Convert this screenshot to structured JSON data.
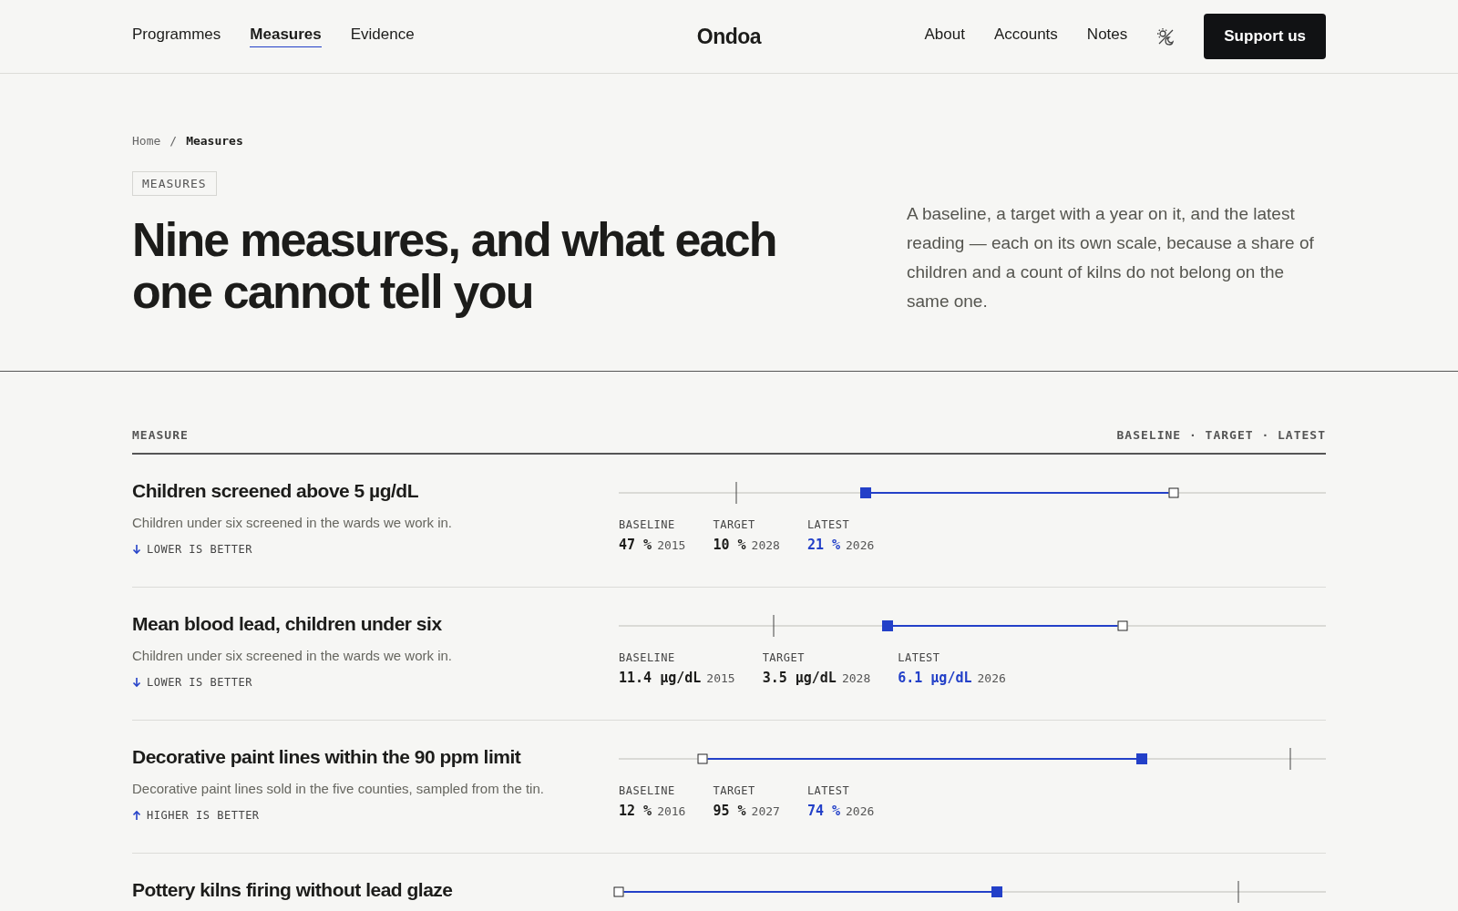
{
  "nav": {
    "left": [
      {
        "label": "Programmes",
        "selected": false
      },
      {
        "label": "Measures",
        "selected": true
      },
      {
        "label": "Evidence",
        "selected": false
      }
    ],
    "logo": "Ondoa",
    "right": [
      {
        "label": "About"
      },
      {
        "label": "Accounts"
      },
      {
        "label": "Notes"
      }
    ],
    "cta": "Support us"
  },
  "breadcrumb": [
    "Home",
    "/",
    "Measures"
  ],
  "tag": "MEASURES",
  "title": "Nine measures, and what each one cannot tell you",
  "intro": "A baseline, a target with a year on it, and the latest reading — each on its own scale, because a share of children and a count of kilns do not belong on the same one.",
  "table": {
    "column_1": "MEASURE",
    "column_2": "BASELINE · TARGET · LATEST",
    "rows": [
      {
        "title": "Children screened above 5 µg/dL",
        "description": "Children under six screened in the wards we work in.",
        "kind": "lower",
        "direction_label": "LOWER IS BETTER",
        "markers": [
          {
            "kind": "baseline",
            "label": "BASELINE",
            "value": "47 %",
            "year": "2015",
            "level": 0.785
          },
          {
            "kind": "target",
            "label": "TARGET",
            "value": "10 %",
            "year": "2028",
            "level": 0.166
          },
          {
            "kind": "latest",
            "label": "LATEST",
            "value": "21 %",
            "year": "2026",
            "level": 0.349
          }
        ]
      },
      {
        "title": "Mean blood lead, children under six",
        "description": "Children under six screened in the wards we work in.",
        "kind": "lower",
        "direction_label": "LOWER IS BETTER",
        "markers": [
          {
            "kind": "baseline",
            "label": "BASELINE",
            "value": "11.4 µg/dL",
            "year": "2015",
            "level": 0.712
          },
          {
            "kind": "target",
            "label": "TARGET",
            "value": "3.5 µg/dL",
            "year": "2028",
            "level": 0.219
          },
          {
            "kind": "latest",
            "label": "LATEST",
            "value": "6.1 µg/dL",
            "year": "2026",
            "level": 0.38
          }
        ]
      },
      {
        "title": "Decorative paint lines within the 90 ppm limit",
        "description": "Decorative paint lines sold in the five counties, sampled from the tin.",
        "kind": "higher",
        "direction_label": "HIGHER IS BETTER",
        "markers": [
          {
            "kind": "baseline",
            "label": "BASELINE",
            "value": "12 %",
            "year": "2016",
            "level": 0.119
          },
          {
            "kind": "target",
            "label": "TARGET",
            "value": "95 %",
            "year": "2027",
            "level": 0.95
          },
          {
            "kind": "latest",
            "label": "LATEST",
            "value": "74 %",
            "year": "2026",
            "level": 0.74
          }
        ]
      },
      {
        "title": "Pottery kilns firing without lead glaze",
        "markers": [
          {
            "kind": "baseline",
            "level": 0.0
          },
          {
            "kind": "target",
            "level": 0.876
          },
          {
            "kind": "latest",
            "level": 0.535
          }
        ]
      }
    ]
  }
}
